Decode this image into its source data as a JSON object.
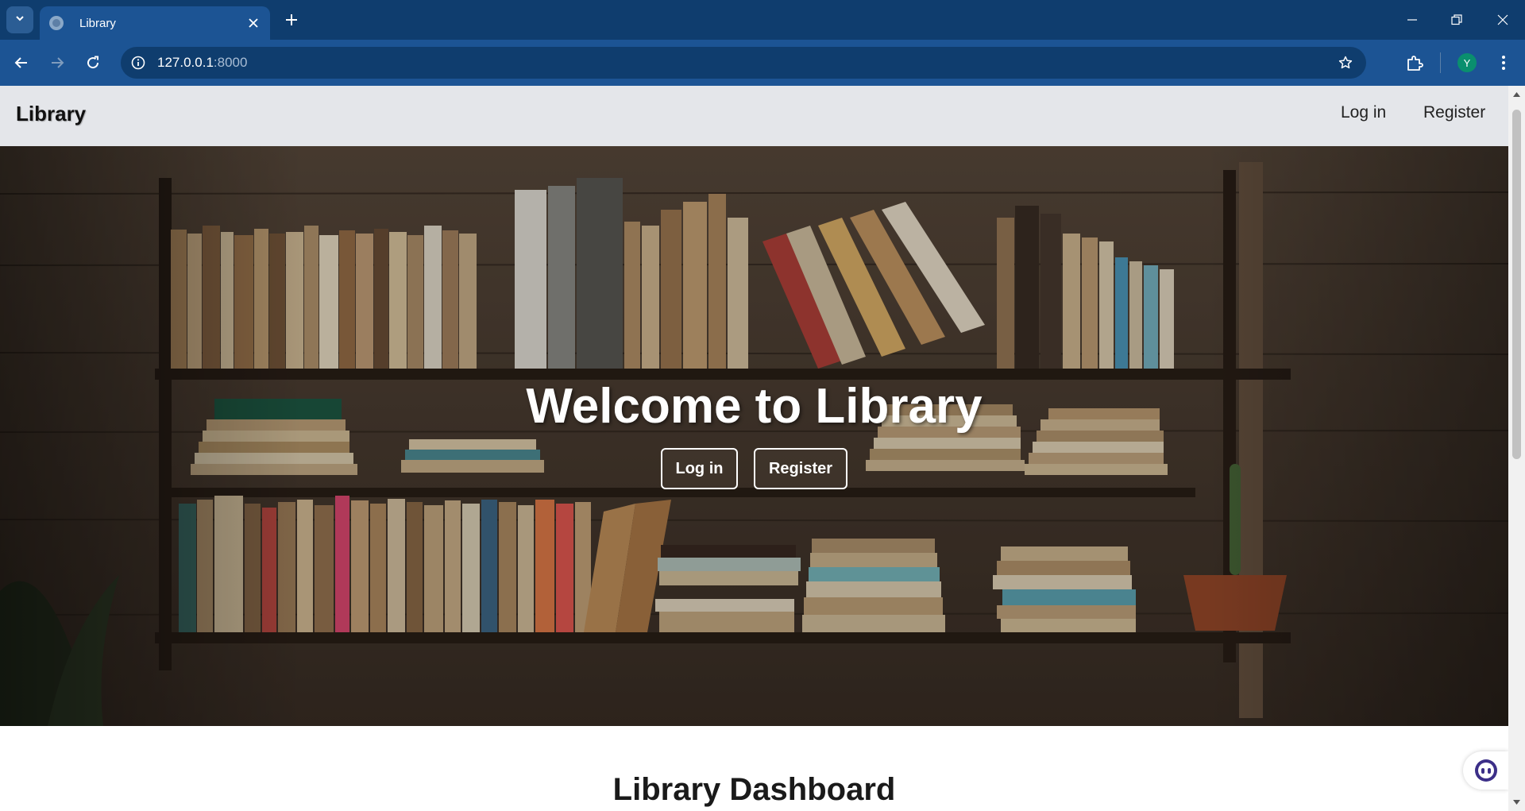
{
  "browser": {
    "tab": {
      "title": "Library"
    },
    "address": {
      "host": "127.0.0.1",
      "port": ":8000"
    },
    "profile_initial": "Y"
  },
  "site": {
    "brand": "Library",
    "nav": {
      "login": "Log in",
      "register": "Register"
    }
  },
  "hero": {
    "title": "Welcome to Library",
    "login_button": "Log in",
    "register_button": "Register"
  },
  "dashboard": {
    "title": "Library Dashboard"
  },
  "colors": {
    "tabbar": "#0f3d6e",
    "toolbar": "#1c5494",
    "site_nav": "#e4e6ea"
  }
}
